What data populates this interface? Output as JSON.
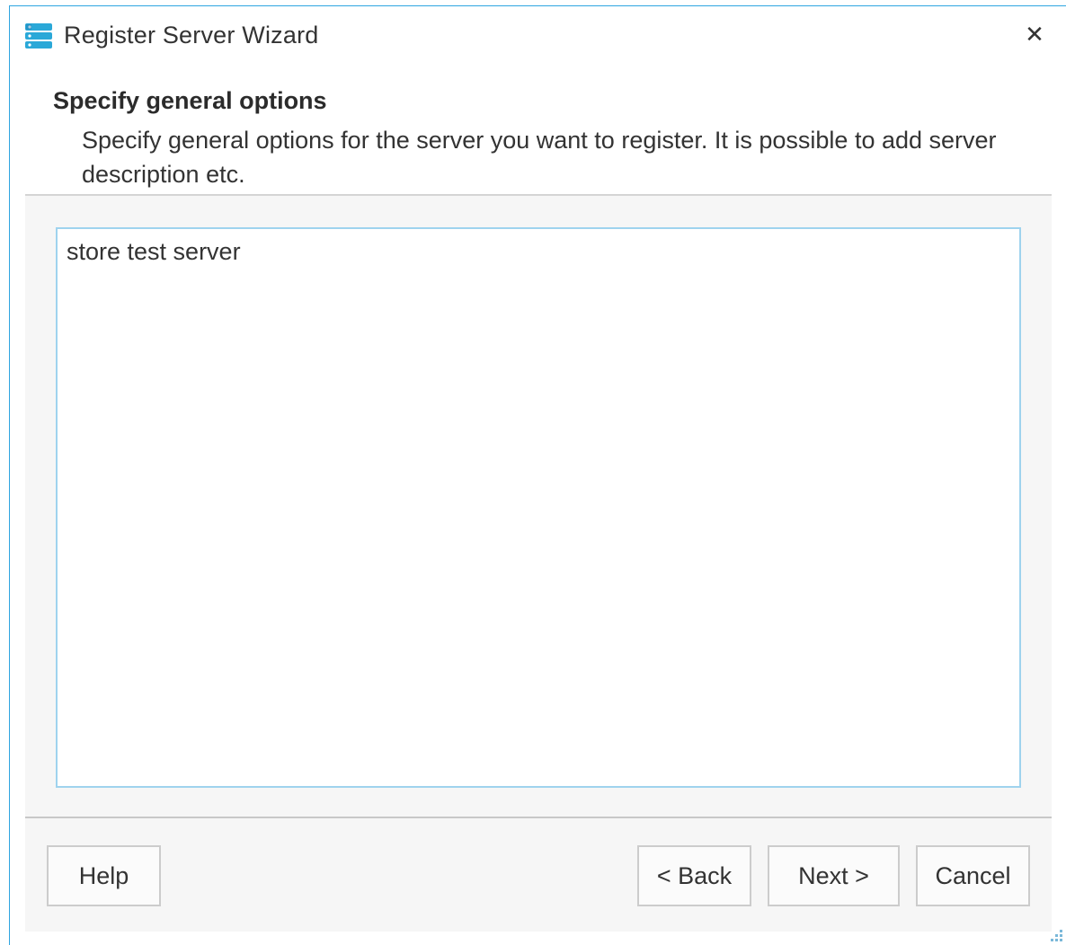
{
  "window": {
    "title": "Register Server Wizard",
    "close_glyph": "✕",
    "accent_color": "#2fa5e0",
    "icon": "server-stack-icon"
  },
  "header": {
    "title": "Specify general options",
    "description": "Specify general options for the server you want to register. It is possible to add server description etc."
  },
  "memo": {
    "value": "store test server"
  },
  "footer": {
    "help_label": "Help",
    "back_label": "< Back",
    "next_label": "Next >",
    "cancel_label": "Cancel"
  }
}
